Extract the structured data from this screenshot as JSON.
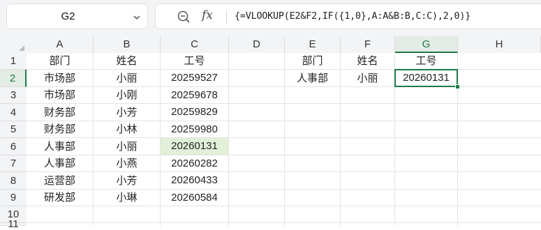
{
  "formula_bar": {
    "name_box": "G2",
    "name_box_icon": "chevron-down-icon",
    "zoom_icon": "zoom-icon",
    "fx_label": "fx",
    "formula": "{=VLOOKUP(E2&F2,IF({1,0},A:A&B:B,C:C),2,0)}"
  },
  "sheet": {
    "columns": [
      "A",
      "B",
      "C",
      "D",
      "E",
      "F",
      "G",
      "H"
    ],
    "active_column": "G",
    "rows": [
      "1",
      "2",
      "3",
      "4",
      "5",
      "6",
      "7",
      "8",
      "9",
      "10",
      "11"
    ],
    "active_row": "2",
    "cells": {
      "A1": "部门",
      "B1": "姓名",
      "C1": "工号",
      "A2": "市场部",
      "B2": "小丽",
      "C2": "20259527",
      "A3": "市场部",
      "B3": "小刚",
      "C3": "20259678",
      "A4": "财务部",
      "B4": "小芳",
      "C4": "20259829",
      "A5": "财务部",
      "B5": "小林",
      "C5": "20259980",
      "A6": "人事部",
      "B6": "小丽",
      "C6": "20260131",
      "A7": "人事部",
      "B7": "小燕",
      "C7": "20260282",
      "A8": "运营部",
      "B8": "小芳",
      "C8": "20260433",
      "A9": "研发部",
      "B9": "小琳",
      "C9": "20260584",
      "E1": "部门",
      "F1": "姓名",
      "G1": "工号",
      "E2": "人事部",
      "F2": "小丽",
      "G2": "20260131"
    },
    "highlighted_cell": "C6",
    "highlight_color": "#e2f0d9",
    "selected_cell": "G2",
    "selection_color": "#1e7a45"
  }
}
